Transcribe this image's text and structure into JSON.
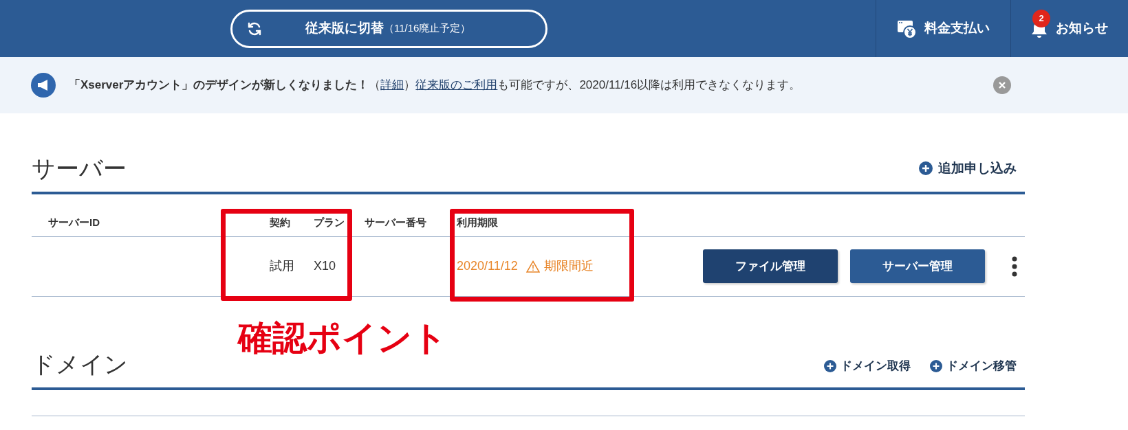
{
  "header": {
    "switch_button": {
      "label": "従来版に切替",
      "note": "（11/16廃止予定）"
    },
    "payment": {
      "label": "料金支払い"
    },
    "notifications": {
      "label": "お知らせ",
      "badge": "2"
    }
  },
  "banner": {
    "text_before": "「Xserverアカウント」のデザインが新しくなりました！",
    "paren_open": "（",
    "detail_link": "詳細",
    "paren_close": "）",
    "legacy_link": "従来版のご利用",
    "text_after": "も可能ですが、2020/11/16以降は利用できなくなります。"
  },
  "server_section": {
    "title": "サーバー",
    "action": "追加申し込み",
    "columns": [
      "サーバーID",
      "契約",
      "プラン",
      "サーバー番号",
      "利用期限"
    ],
    "rows": [
      {
        "server_id": "",
        "contract": "試用",
        "plan": "X10",
        "number": "",
        "expiry": "2020/11/12",
        "warning": "期限間近",
        "buttons": [
          {
            "label": "ファイル管理",
            "kind": "dark"
          },
          {
            "label": "サーバー管理",
            "kind": "primary"
          }
        ]
      }
    ]
  },
  "domain_section": {
    "title": "ドメイン",
    "actions": [
      "ドメイン取得",
      "ドメイン移管"
    ]
  },
  "annotations": {
    "boxes": [
      {
        "kind": "box"
      },
      {
        "kind": "box"
      }
    ],
    "callout": "確認ポイント"
  }
}
